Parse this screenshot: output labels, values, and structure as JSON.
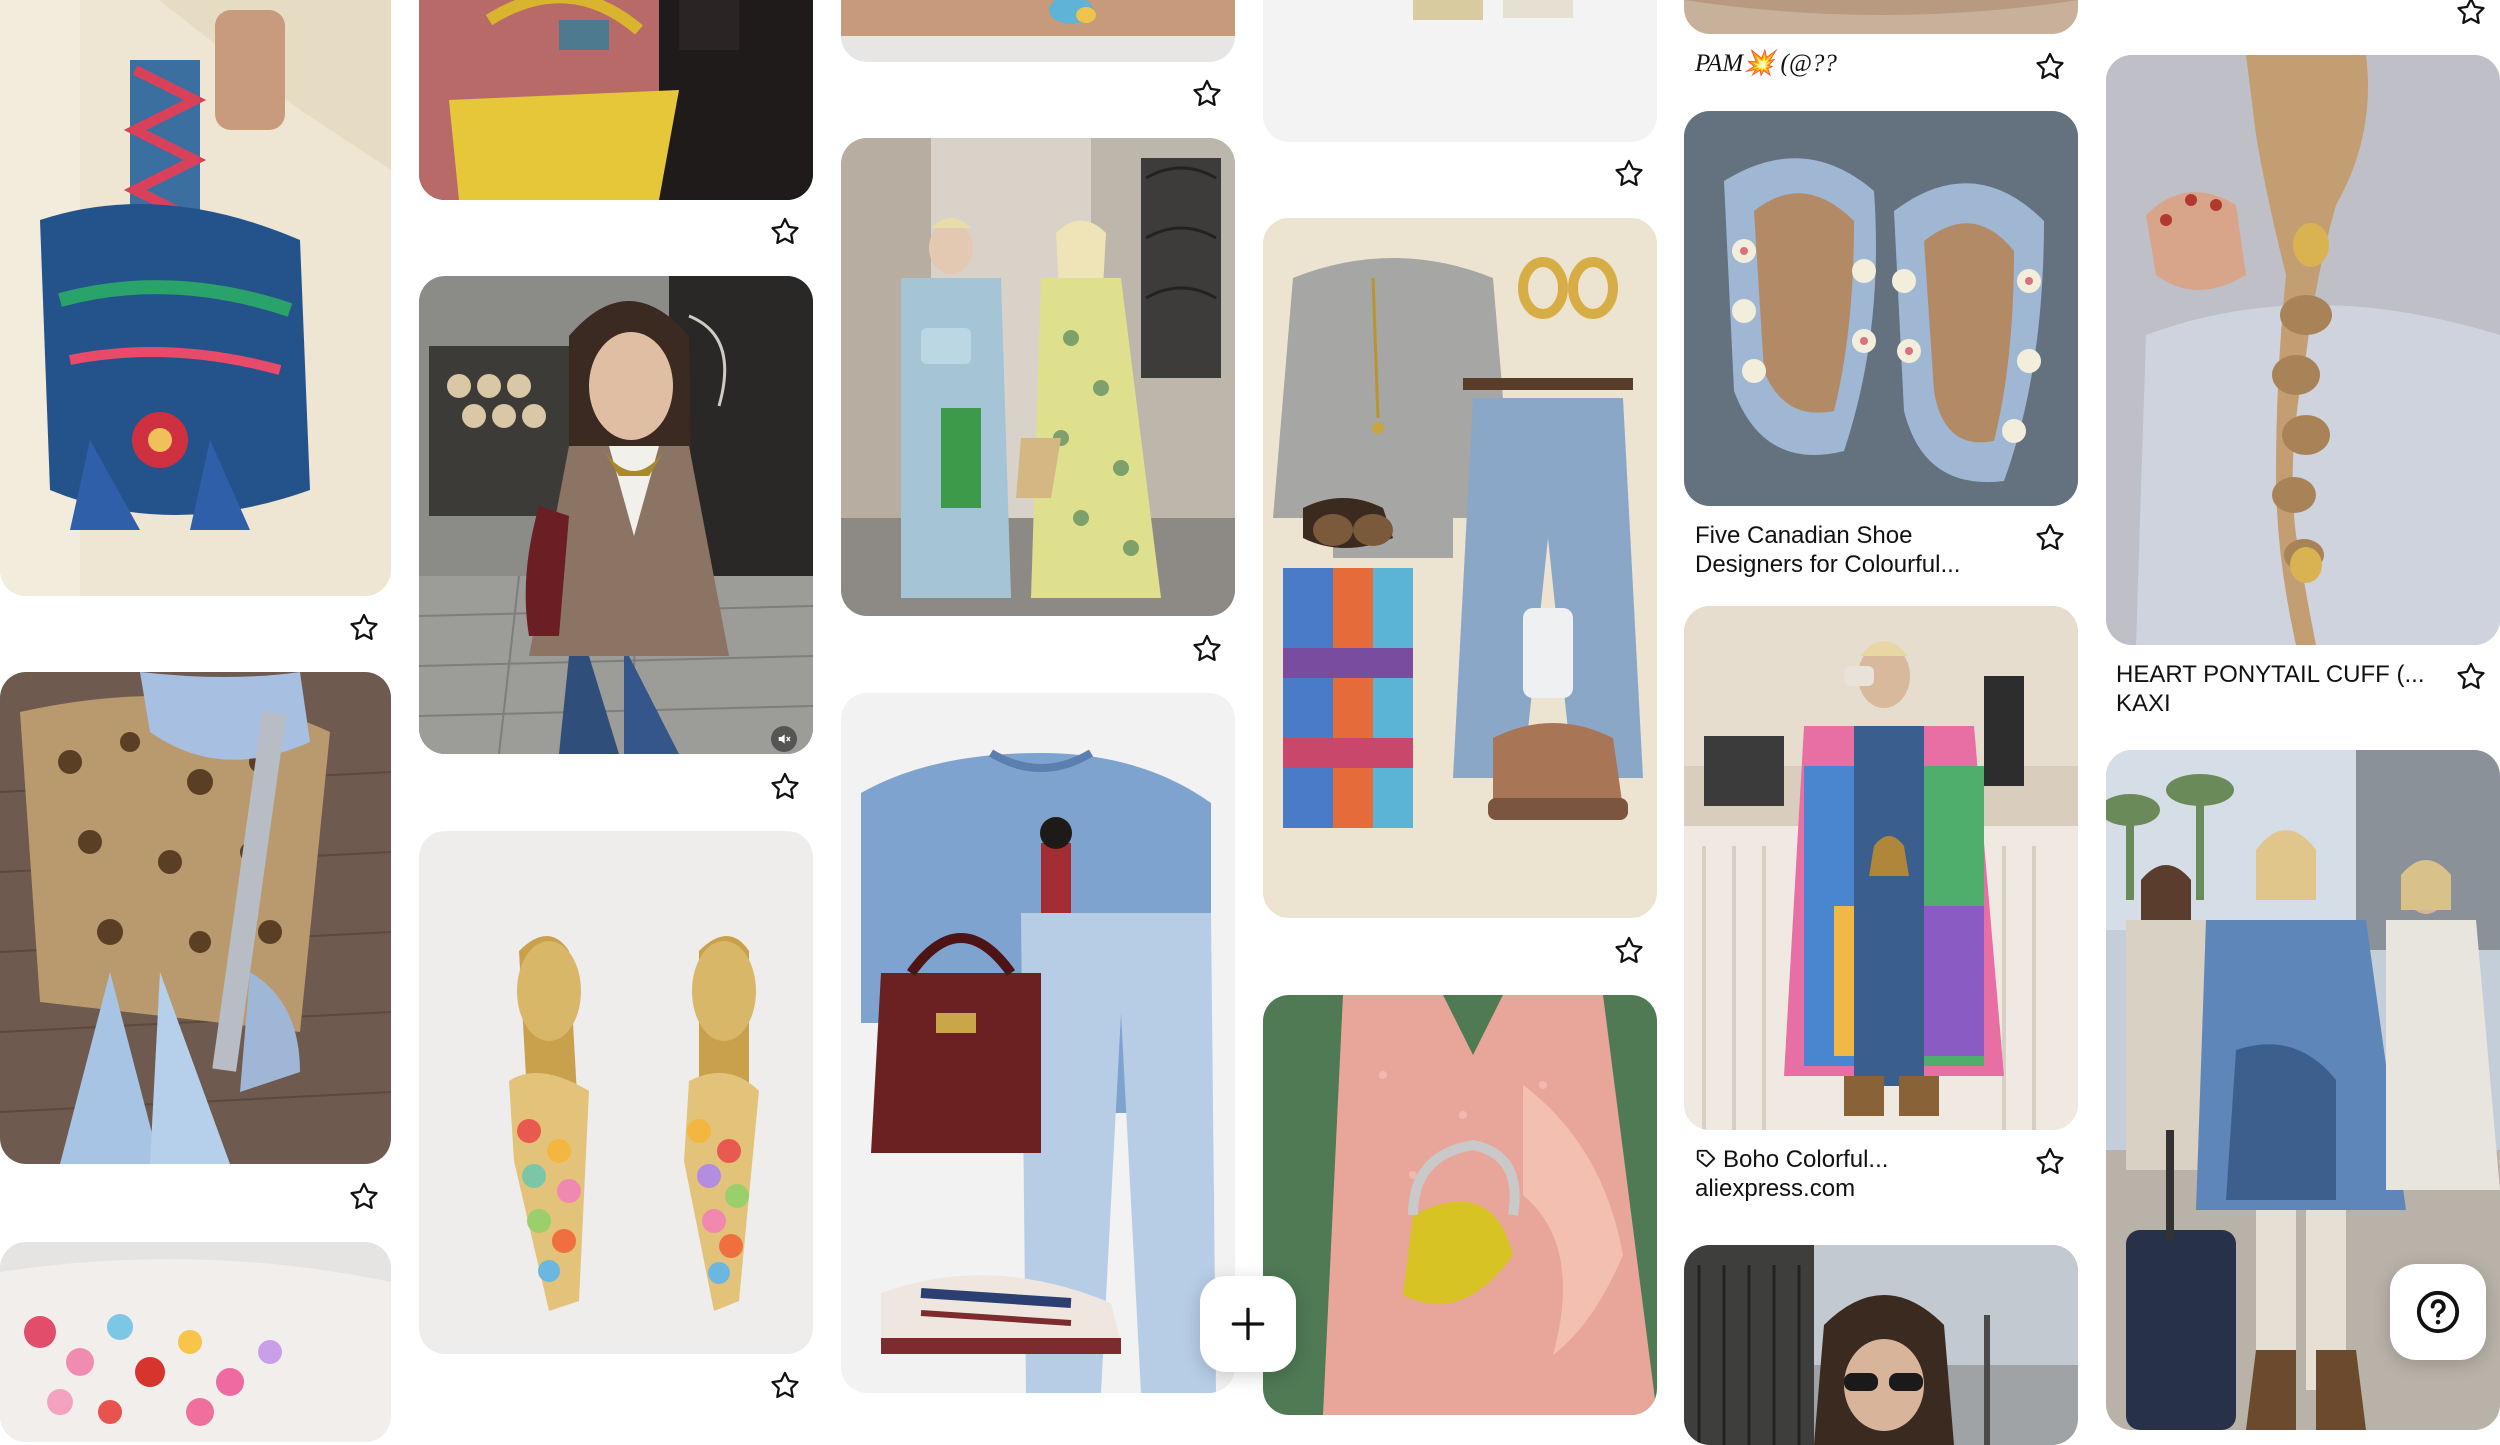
{
  "colors": {
    "star_stroke": "#111111",
    "caption_text": "#111111"
  },
  "pins": [
    {
      "id": "bag-embroidered-bucket",
      "caption": null
    },
    {
      "id": "yellow-tote",
      "caption": null
    },
    {
      "id": "gold-sandal-top",
      "caption": null
    },
    {
      "id": "cream-shoes-top",
      "caption": null
    },
    {
      "id": "sandy-top",
      "caption": null
    },
    {
      "id": "braid-ponytail",
      "caption": {
        "title": "HEART PONYTAIL CUFF (...",
        "subtitle": "KAXI"
      }
    },
    {
      "id": "leopard-jacket",
      "caption": null
    },
    {
      "id": "scarf-cardigan-video",
      "caption": null
    },
    {
      "id": "street-style-duo",
      "caption": null
    },
    {
      "id": "grey-sweater-flatlay",
      "caption": null
    },
    {
      "id": "ruffle-shoes",
      "caption": {
        "title": "Five Canadian Shoe",
        "subtitle": "Designers for Colourful..."
      }
    },
    {
      "id": "friends-airport",
      "caption": null
    },
    {
      "id": "beaded-heels",
      "caption": null
    },
    {
      "id": "blue-sweater-flatlay",
      "caption": null
    },
    {
      "id": "pink-sequin-dress",
      "caption": null
    },
    {
      "id": "boho-cardigan",
      "caption": {
        "title": "Boho Colorful...",
        "subtitle": "aliexpress.com"
      }
    },
    {
      "id": "beaded-bag-bottom",
      "caption": null
    },
    {
      "id": "sunglasses-street",
      "caption": null
    }
  ],
  "handle_caption": "PAM💥 (@??",
  "icons": {
    "save": "star-outline-icon",
    "create": "plus-icon",
    "help": "question-mark-icon",
    "muted": "muted-speaker-icon",
    "promoted": "tag-icon"
  }
}
